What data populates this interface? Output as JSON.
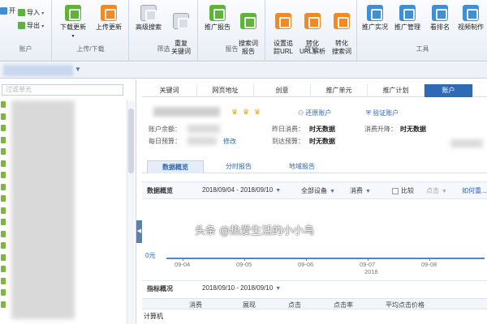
{
  "ribbon": {
    "account_group": {
      "label": "账户",
      "open_label": "开",
      "import_label": "导入",
      "export_label": "导出"
    },
    "upload_group": {
      "label": "上传/下载",
      "download_label": "下载更新",
      "upload_label": "上传更新"
    },
    "filter_group": {
      "label": "筛选",
      "advanced_search_label": "高级搜索",
      "duplicate_keywords_label": "重复\n关键词"
    },
    "report_group": {
      "label": "报告",
      "promo_report_label": "推广报告",
      "search_term_report_label": "搜索词\n报告"
    },
    "convert_group": {
      "label": "转化",
      "set_tracking_label": "设置追\n踪URL",
      "convert_url_label": "转化\nURL解析",
      "convert_search_label": "转化\n搜索词"
    },
    "tools_group": {
      "label": "工具",
      "promo_live_label": "推广实况",
      "promo_manage_label": "推广管理",
      "ranking_label": "看排名",
      "video_label": "视频制作"
    }
  },
  "tree": {
    "search_placeholder": "过滤单元"
  },
  "tabs": [
    {
      "label": "关键词"
    },
    {
      "label": "网页地址"
    },
    {
      "label": "创意"
    },
    {
      "label": "推广单元"
    },
    {
      "label": "推广计划"
    },
    {
      "label": "账户"
    }
  ],
  "account": {
    "restore_link": "还原账户",
    "verify_link": "验证账户",
    "balance_label": "账户余额：",
    "daily_budget_label": "每日预算：",
    "modify_link": "修改",
    "yesterday_label": "昨日消费：",
    "yesterday_value": "时无数据",
    "zone_budget_label": "到达预算：",
    "zone_budget_value": "时无数据",
    "spend_rank_label": "消费升降：",
    "spend_rank_value": "时无数据"
  },
  "subtabs": [
    {
      "label": "数据概览"
    },
    {
      "label": "分时报告"
    },
    {
      "label": "地域报告"
    }
  ],
  "filter": {
    "title": "数据概览",
    "date_range": "2018/09/04 - 2018/09/10",
    "device": "全部设备",
    "metric": "消费",
    "compare_label": "比较",
    "click_label": "点击",
    "how_label": "如何重..."
  },
  "chart_data": {
    "type": "line",
    "ylabel": "0元",
    "x": [
      "09-04",
      "09-05",
      "09-06",
      "09-07",
      "09-08"
    ],
    "series": [
      {
        "values": [
          0,
          0,
          0,
          0,
          0
        ]
      }
    ],
    "year_label": "2018",
    "grid": false
  },
  "metrics": {
    "title": "指标概况",
    "date_range": "2018/09/10 - 2018/09/10",
    "columns": [
      "消费",
      "展现",
      "点击",
      "点击率",
      "平均点击价格"
    ],
    "row_label": "计算机"
  },
  "watermark": "头条 @热爱生活的小小鸟",
  "colors": {
    "accent": "#2f6bb5",
    "link": "#2e67b1",
    "chart_line": "#4f86c6"
  }
}
